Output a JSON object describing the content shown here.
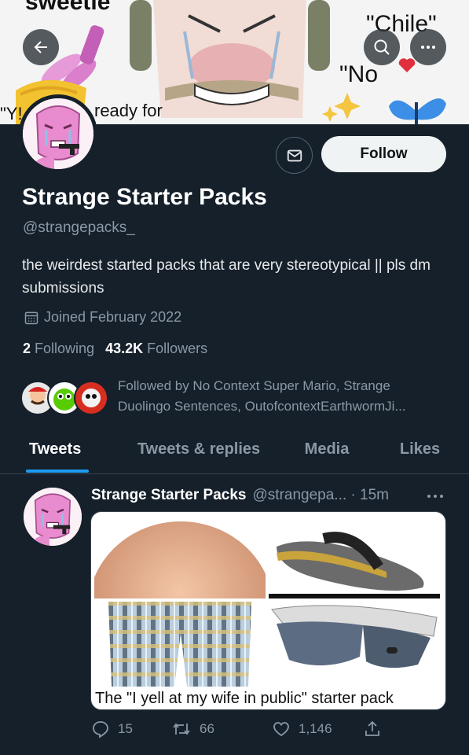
{
  "banner": {
    "text_sweetie": "sweetie",
    "text_chile": "\"Chile\"",
    "text_no": "\"No",
    "text_ready": "ready for",
    "text_y": "\"Y!"
  },
  "profile": {
    "display_name": "Strange Starter Packs",
    "handle": "@strangepacks_",
    "bio": "the weirdest started packs that are very stereotypical || pls dm submissions",
    "joined": "Joined February 2022",
    "following_count": "2",
    "following_label": "Following",
    "followers_count": "43.2K",
    "followers_label": "Followers",
    "followed_by": "Followed by No Context Super Mario, Strange Duolingo Sentences, OutofcontextEarthwormJi..."
  },
  "actions": {
    "follow_label": "Follow"
  },
  "tabs": [
    {
      "label": "Tweets",
      "active": true
    },
    {
      "label": "Tweets & replies",
      "active": false
    },
    {
      "label": "Media",
      "active": false
    },
    {
      "label": "Likes",
      "active": false
    }
  ],
  "tweet": {
    "name": "Strange Starter Packs",
    "meta": "@strangepa... · 15m",
    "caption": "The \"I yell at my wife in public\" starter pack",
    "reply_count": "15",
    "retweet_count": "66",
    "like_count": "1,146"
  },
  "icons": {
    "back": "arrow-left-icon",
    "search": "search-icon",
    "more": "more-icon",
    "message": "envelope-icon",
    "calendar": "calendar-icon",
    "reply": "reply-icon",
    "retweet": "retweet-icon",
    "like": "heart-icon",
    "share": "share-icon"
  },
  "colors": {
    "background": "#15202b",
    "accent": "#1d9bf0",
    "muted_text": "#8b98a5",
    "follow_button": "#eff3f4"
  }
}
